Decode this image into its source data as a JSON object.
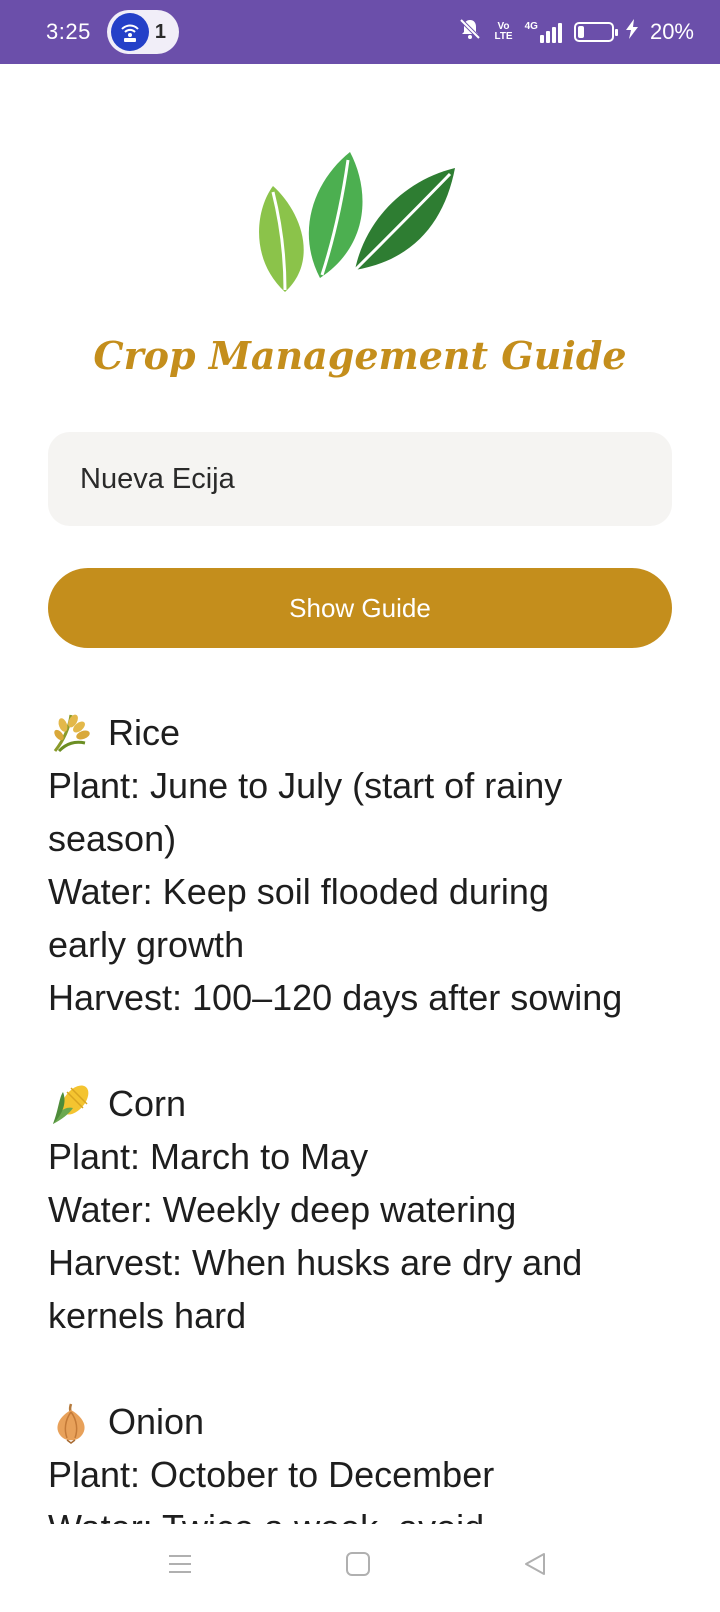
{
  "status_bar": {
    "time": "3:25",
    "notification_count": "1",
    "network_label": "4G",
    "volte_top": "Vo",
    "volte_bottom": "LTE",
    "battery": "20%",
    "battery_level": 0.2,
    "icons": [
      "hotspot-icon",
      "mute-icon",
      "volte-icon",
      "signal-icon",
      "battery-icon",
      "charging-icon"
    ]
  },
  "header": {
    "logo_icon": "leaves-icon",
    "title": "Crop Management Guide"
  },
  "form": {
    "location_value": "Nueva Ecija",
    "button_label": "Show Guide"
  },
  "colors": {
    "accent": "#c48e1c",
    "status_bar": "#6b4faa"
  },
  "crops": [
    {
      "icon": "rice-icon",
      "name": "Rice",
      "lines": [
        "Plant: June to July (start of rainy",
        "season)",
        "Water: Keep soil flooded during",
        "early growth",
        "Harvest: 100–120 days after sowing"
      ]
    },
    {
      "icon": "corn-icon",
      "name": "Corn",
      "lines": [
        "Plant: March to May",
        "Water: Weekly deep watering",
        "Harvest: When husks are dry and",
        "kernels hard"
      ]
    },
    {
      "icon": "onion-icon",
      "name": "Onion",
      "lines": [
        "Plant: October to December",
        "Water: Twice a week, avoid"
      ]
    }
  ],
  "nav": {
    "icons": [
      "menu-icon",
      "home-icon",
      "back-icon"
    ]
  }
}
